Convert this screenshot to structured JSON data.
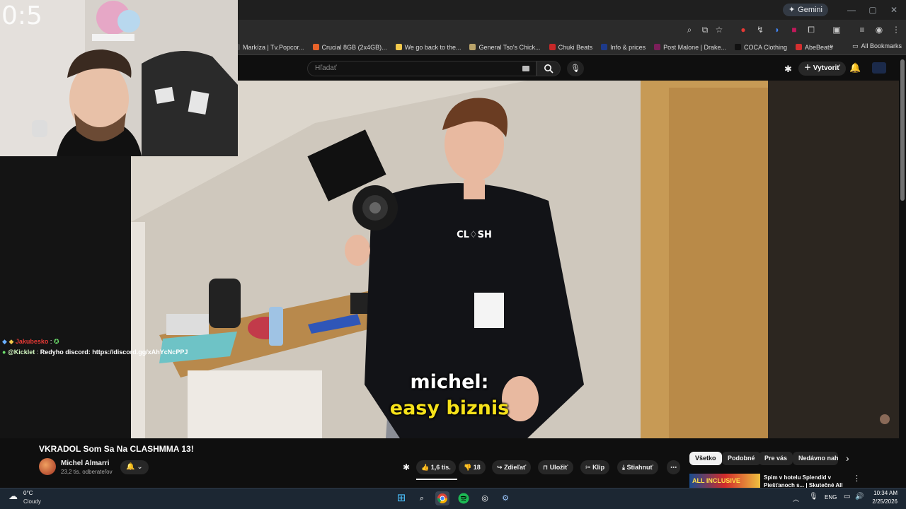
{
  "browser": {
    "gemini_label": "Gemini",
    "bookmarks": [
      {
        "label": "Markíza | Tv.Popcor...",
        "color": "#444"
      },
      {
        "label": "Crucial 8GB (2x4GB)...",
        "color": "#e8632a"
      },
      {
        "label": "We go back to the...",
        "color": "#f2c94c"
      },
      {
        "label": "General Tso's Chick...",
        "color": "#b9a36a"
      },
      {
        "label": "Chuki Beats",
        "color": "#c62828"
      },
      {
        "label": "Info & prices",
        "color": "#1e3a8a"
      },
      {
        "label": "Post Malone | Drake...",
        "color": "#7b1f5a"
      },
      {
        "label": "COCA Clothing",
        "color": "#111"
      },
      {
        "label": "AbeBeats",
        "color": "#d32f2f"
      }
    ],
    "all_bookmarks": "All Bookmarks"
  },
  "youtube": {
    "search_placeholder": "Hľadať",
    "create_label": "Vytvoriť"
  },
  "stream": {
    "timer": "0:5",
    "chat": [
      {
        "user": "Jakubesko",
        "text": ""
      },
      {
        "user": "@Kicklet",
        "text": "Redyho discord: https://discord.gg/xAhYcNcPPJ"
      }
    ]
  },
  "video": {
    "subtitle_line1": "michel:",
    "subtitle_line2": "easy biznis",
    "title": "VKRADOL Som Sa Na CLASHMMA 13!",
    "channel": "Michel Almarri",
    "subscribers": "23,2 tis. odberateľov",
    "likes": "1,6 tis.",
    "dislikes": "18",
    "share_label": "Zdieľať",
    "save_label": "Uložiť",
    "clip_label": "Klip",
    "download_label": "Stiahnuť"
  },
  "chips": [
    "Všetko",
    "Podobné",
    "Pre vás",
    "Nedávno nahra"
  ],
  "recommendation": {
    "thumb_text": "ALL INCLUSIVE",
    "title": "Spim v hotelu Splendid v Piešťanoch s... | Skutečné All"
  },
  "taskbar": {
    "temp": "0°C",
    "weather": "Cloudy",
    "lang": "ENG",
    "time": "10:34 AM",
    "date": "2/25/2026"
  }
}
